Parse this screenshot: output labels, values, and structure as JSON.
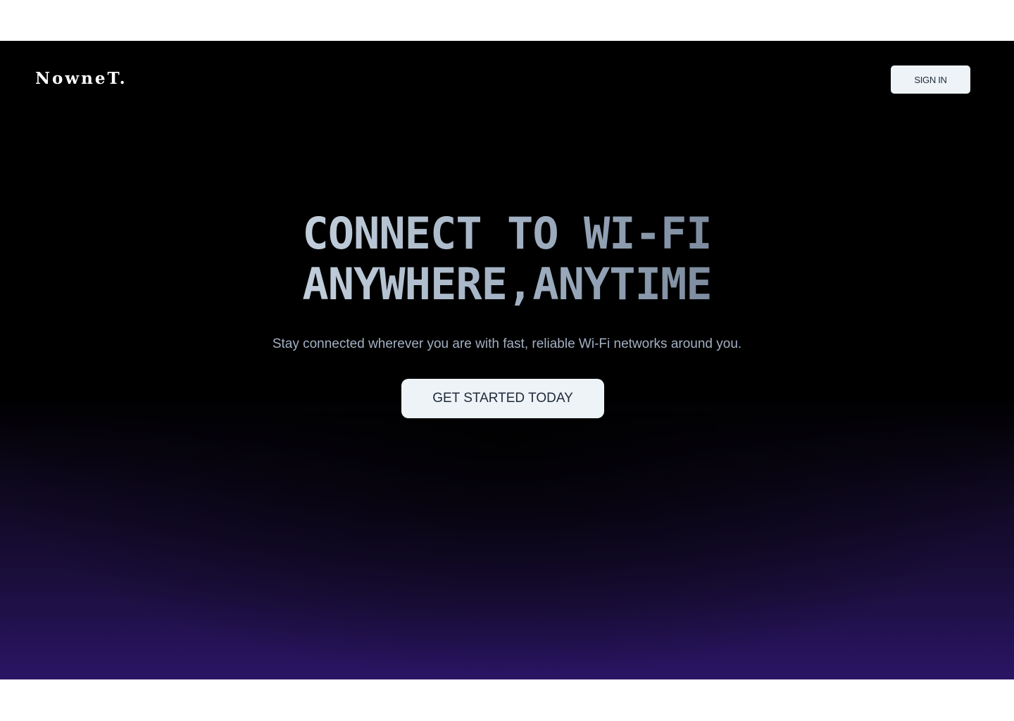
{
  "header": {
    "logo": "NowneT.",
    "sign_in_label": "SIGN IN"
  },
  "hero": {
    "headline_line1": "CONNECT TO WI-FI",
    "headline_line2": "ANYWHERE,ANYTIME",
    "subtitle": "Stay connected wherever you are with fast, reliable Wi-Fi networks around you.",
    "cta_label": "GET STARTED TODAY"
  },
  "colors": {
    "background": "#000000",
    "gradient_bottom": "#2a1565",
    "button_bg": "#eef3f7",
    "button_text": "#1e2a3a",
    "headline": "#a7b5c6",
    "subtitle": "#a2b0c2"
  }
}
